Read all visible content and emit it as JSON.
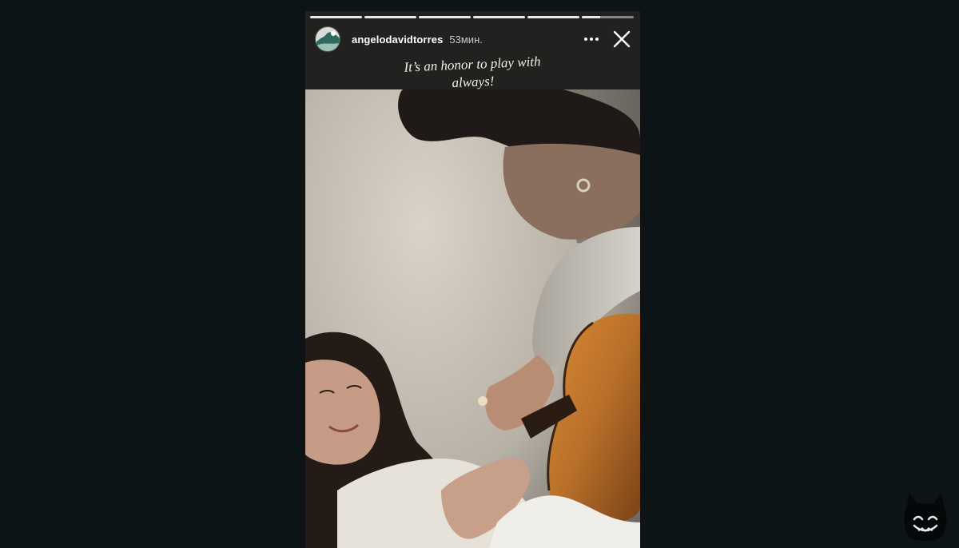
{
  "story": {
    "username": "angelodavidtorres",
    "timestamp": "53мин.",
    "caption_line1": "It’s an honor to play with",
    "caption_line2": "always!",
    "progress_segments": [
      {
        "fill": 1.0
      },
      {
        "fill": 1.0
      },
      {
        "fill": 1.0
      },
      {
        "fill": 1.0
      },
      {
        "fill": 1.0
      },
      {
        "fill": 0.35
      }
    ]
  },
  "icons": {
    "more": "more-dots-icon",
    "close": "close-icon",
    "avatar": "avatar-image",
    "watermark": "cat-logo-watermark"
  },
  "colors": {
    "background": "#0d1416",
    "text": "#ffffff",
    "guitar": "#b9702a"
  }
}
